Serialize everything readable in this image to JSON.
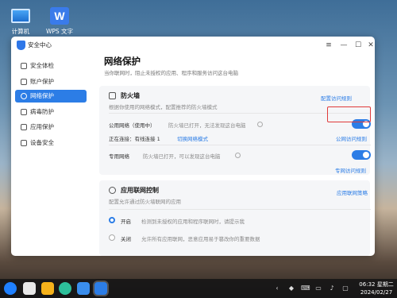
{
  "desktop": {
    "icons": [
      {
        "label": "计算机"
      },
      {
        "label": "WPS 文字",
        "glyph": "W"
      }
    ]
  },
  "window": {
    "title": "安全中心",
    "controls": {
      "menu": "≡",
      "minimize": "—",
      "maximize": "☐",
      "close": "✕"
    }
  },
  "sidebar": {
    "items": [
      {
        "label": "安全体检",
        "icon": "shield-check-icon"
      },
      {
        "label": "账户保护",
        "icon": "user-icon"
      },
      {
        "label": "网络保护",
        "icon": "globe-icon",
        "active": true
      },
      {
        "label": "病毒防护",
        "icon": "virus-icon"
      },
      {
        "label": "应用保护",
        "icon": "app-shield-icon"
      },
      {
        "label": "设备安全",
        "icon": "device-icon"
      }
    ]
  },
  "main": {
    "title": "网络保护",
    "subtitle": "当你联网时，阻止未授权的应用、程序和服务访问这台电脑",
    "firewall": {
      "title": "防火墙",
      "subtitle": "根据你使用的网络模式，配置推荐的防火墙模式",
      "config_link": "配置访问规则",
      "public": {
        "label": "公用网络（使用中）",
        "desc": "防火墙已打开，无法发现这台电脑",
        "enabled": true,
        "link": "公网访问规则"
      },
      "connected": {
        "label": "正在连接：有线连接 1",
        "link": "切换网络模式"
      },
      "private": {
        "label": "专用网络",
        "desc": "防火墙已打开，可以发现这台电脑",
        "enabled": true,
        "link": "专网访问规则"
      }
    },
    "app_control": {
      "title": "应用联网控制",
      "subtitle": "配置允许通过防火墙联网的应用",
      "link": "应用联网策略",
      "options": [
        {
          "label": "开启",
          "desc": "检测到未授权的应用和程序联网时，请提示我",
          "selected": true
        },
        {
          "label": "关闭",
          "desc": "允许所有应用联网，恶意应用易于篡改你的重要数据",
          "selected": false
        }
      ]
    }
  },
  "taskbar": {
    "tray": {
      "chevron": "‹",
      "clock_time": "06:32 星期二",
      "clock_date": "2024/02/27"
    }
  },
  "colors": {
    "accent": "#2c7de6",
    "highlight": "#e03a3a"
  }
}
